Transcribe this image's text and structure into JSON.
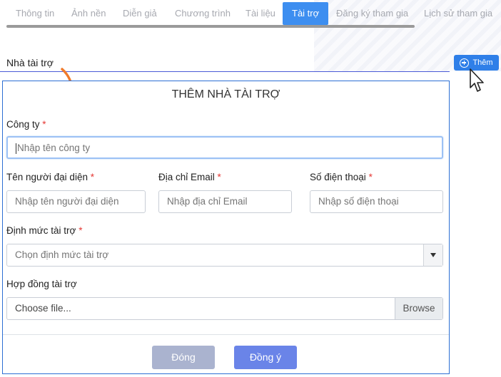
{
  "tabs": [
    {
      "label": "Thông tin"
    },
    {
      "label": "Ảnh nền"
    },
    {
      "label": "Diễn giả"
    },
    {
      "label": "Chương trình"
    },
    {
      "label": "Tài liệu"
    },
    {
      "label": "Tài trợ",
      "active": true
    },
    {
      "label": "Đăng ký tham gia"
    },
    {
      "label": "Lịch sử tham gia"
    }
  ],
  "section": {
    "label": "Nhà tài trợ",
    "add_label": "Thêm"
  },
  "modal": {
    "title": "THÊM NHÀ TÀI TRỢ",
    "company": {
      "label": "Công ty",
      "placeholder": "Nhập tên công ty"
    },
    "representative": {
      "label": "Tên người đại diện",
      "placeholder": "Nhập tên người đại diện"
    },
    "email": {
      "label": "Địa chỉ Email",
      "placeholder": "Nhập địa chỉ Email"
    },
    "phone": {
      "label": "Số điện thoại",
      "placeholder": "Nhập số điện thoại"
    },
    "level": {
      "label": "Định mức tài trợ",
      "placeholder": "Chọn định mức tài trợ"
    },
    "contract": {
      "label": "Hợp đồng tài trợ",
      "placeholder": "Choose file...",
      "browse": "Browse"
    },
    "required_mark": "*",
    "close_label": "Đóng",
    "ok_label": "Đồng ý"
  },
  "colors": {
    "accent": "#3d8ef0",
    "button_primary": "#6a84e8",
    "button_disabled": "#aab3cf",
    "required": "#e53935",
    "annotation_arrow": "#f07a2a"
  }
}
